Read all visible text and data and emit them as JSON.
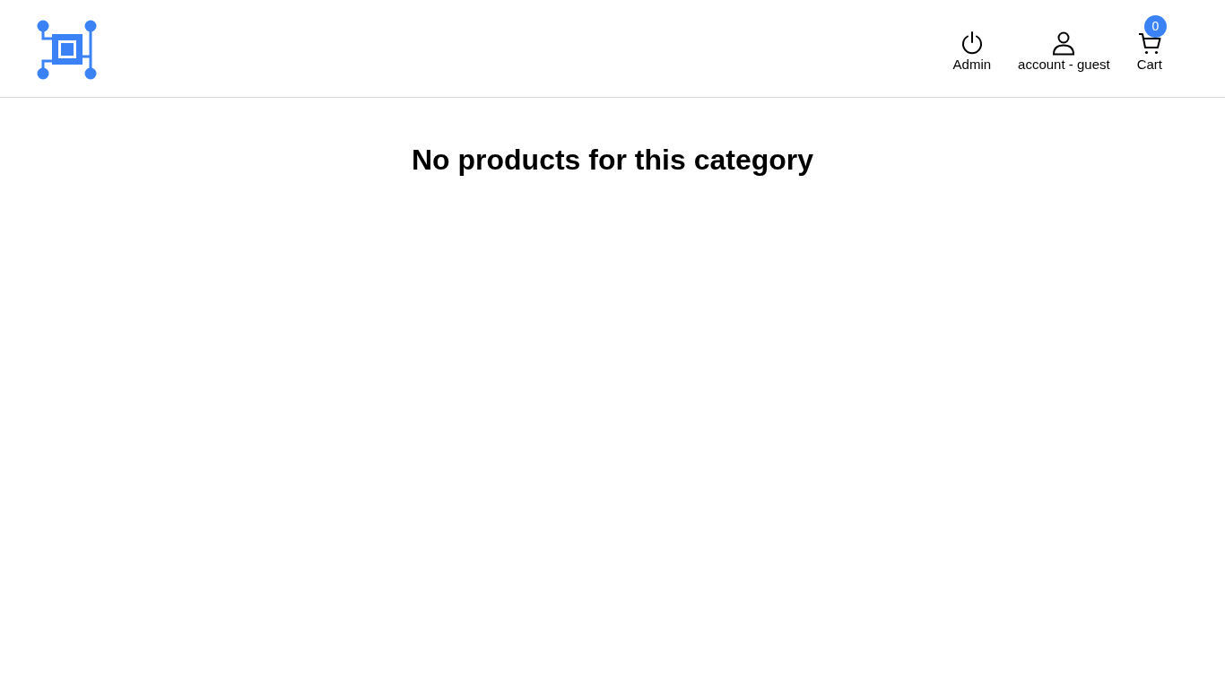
{
  "header": {
    "nav": [
      {
        "kind": "power",
        "label": "Admin"
      },
      {
        "kind": "user",
        "label": "account - guest"
      },
      {
        "kind": "cart",
        "label": "Cart",
        "badge": "0"
      }
    ]
  },
  "main": {
    "message": "No products for this category"
  }
}
